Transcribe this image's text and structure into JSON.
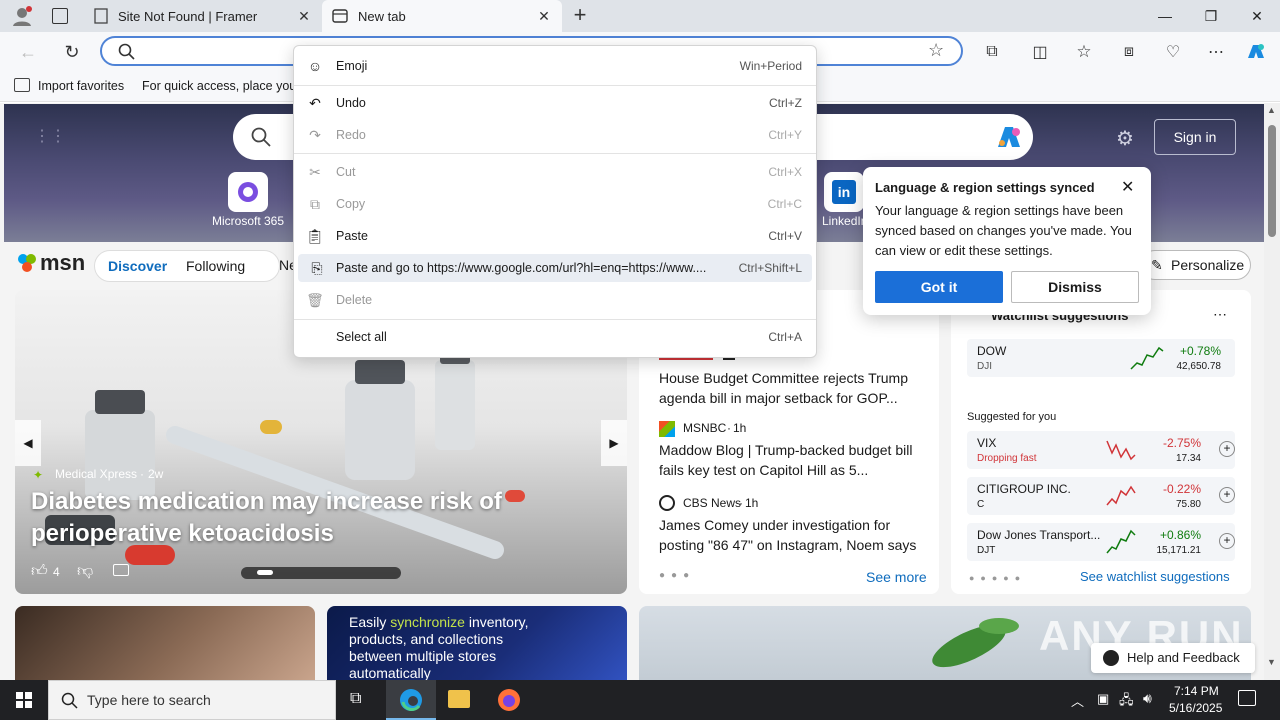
{
  "tabs": [
    {
      "title": "Site Not Found | Framer"
    },
    {
      "title": "New tab"
    }
  ],
  "favorites_bar": {
    "import": "Import favorites",
    "hint": "For quick access, place your f"
  },
  "context_menu": [
    {
      "label": "Emoji",
      "shortcut": "Win+Period",
      "disabled": false
    },
    {
      "label": "Undo",
      "shortcut": "Ctrl+Z",
      "disabled": false
    },
    {
      "label": "Redo",
      "shortcut": "Ctrl+Y",
      "disabled": true
    },
    {
      "label": "Cut",
      "shortcut": "Ctrl+X",
      "disabled": true
    },
    {
      "label": "Copy",
      "shortcut": "Ctrl+C",
      "disabled": true
    },
    {
      "label": "Paste",
      "shortcut": "Ctrl+V",
      "disabled": false
    },
    {
      "label": "Paste and go to https://www.google.com/url?hl=enq=https://www....",
      "shortcut": "Ctrl+Shift+L",
      "disabled": false
    },
    {
      "label": "Delete",
      "shortcut": "",
      "disabled": true
    },
    {
      "label": "Select all",
      "shortcut": "Ctrl+A",
      "disabled": false
    }
  ],
  "sync_popup": {
    "title": "Language & region settings synced",
    "body": "Your language & region settings have been synced based on changes you've made. You can view or edit these settings.",
    "primary": "Got it",
    "secondary": "Dismiss"
  },
  "hero": {
    "sign_in": "Sign in",
    "tile_m365": "Microsoft 365",
    "tile_linkedin": "LinkedIn"
  },
  "msn": {
    "logo": "msn",
    "nav": [
      "Discover",
      "Following",
      "Ne"
    ],
    "personalize": "Personalize"
  },
  "main_story": {
    "source": "Medical Xpress",
    "age": "2w",
    "headline": "Diabetes medication may increase risk of perioperative ketoacidosis",
    "likes": "4"
  },
  "news": [
    {
      "source": "",
      "age": "",
      "headline": "House Budget Committee rejects Trump agenda bill in major setback for GOP..."
    },
    {
      "source": "MSNBC",
      "age": "1h",
      "headline": "Maddow Blog | Trump-backed budget bill fails key test on Capitol Hill as 5..."
    },
    {
      "source": "CBS News",
      "age": "1h",
      "headline": "James Comey under investigation for posting \"86 47\" on Instagram, Noem says"
    }
  ],
  "see_more": "See more",
  "watchlist": {
    "title": "Watchlist suggestions",
    "dow": {
      "name": "DOW",
      "ticker": "DJI",
      "change": "+0.78%",
      "price": "42,650.78"
    },
    "suggested_label": "Suggested for you",
    "items": [
      {
        "name": "VIX",
        "sub": "Dropping fast",
        "change": "-2.75%",
        "price": "17.34",
        "up": false
      },
      {
        "name": "CITIGROUP INC.",
        "sub": "C",
        "change": "-0.22%",
        "price": "75.80",
        "up": false
      },
      {
        "name": "Dow Jones Transport...",
        "sub": "DJT",
        "change": "+0.86%",
        "price": "15,171.21",
        "up": true
      }
    ],
    "link": "See watchlist suggestions"
  },
  "promo": {
    "pre": "Easily ",
    "highlight": "synchronize",
    "post": " inventory, products, and collections between multiple stores automatically"
  },
  "help": "Help and Feedback",
  "watermark": "ANY RUN",
  "taskbar": {
    "search": "Type here to search",
    "time": "7:14 PM",
    "date": "5/16/2025"
  },
  "colors": {
    "accent": "#0f6cbd",
    "popup_button": "#1b6fd8",
    "negative": "#d13438",
    "positive": "#107c10"
  }
}
